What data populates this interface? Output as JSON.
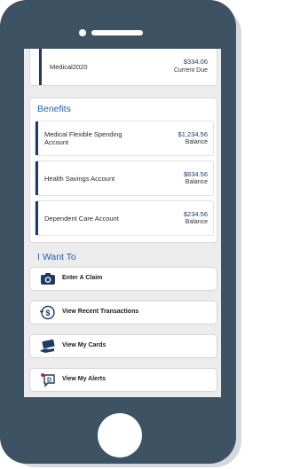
{
  "top_item": {
    "title": "Medical2020",
    "amount": "$334.06",
    "status": "Current Due"
  },
  "benefits": {
    "title": "Benefits",
    "items": [
      {
        "title_line1": "Medical Flexible Spending",
        "title_line2": "Account",
        "amount": "$1,234.56",
        "label": "Balance"
      },
      {
        "title_line1": "Health Savings Account",
        "title_line2": "",
        "amount": "$834.56",
        "label": "Balance"
      },
      {
        "title_line1": "Dependent Care Account",
        "title_line2": "",
        "amount": "$234.56",
        "label": "Balance"
      }
    ]
  },
  "i_want_to": {
    "title": "I Want To",
    "actions": [
      {
        "label": "Enter A Claim",
        "icon": "camera-icon"
      },
      {
        "label": "View Recent Transactions",
        "icon": "dollar-cycle-icon"
      },
      {
        "label": "View My Cards",
        "icon": "card-hand-icon"
      },
      {
        "label": "View My Alerts",
        "icon": "alert-bubble-icon"
      }
    ]
  },
  "colors": {
    "frame": "#3d5262",
    "accent": "#1f3a66",
    "heading": "#1f5fae",
    "screen_bg": "#ececec"
  }
}
